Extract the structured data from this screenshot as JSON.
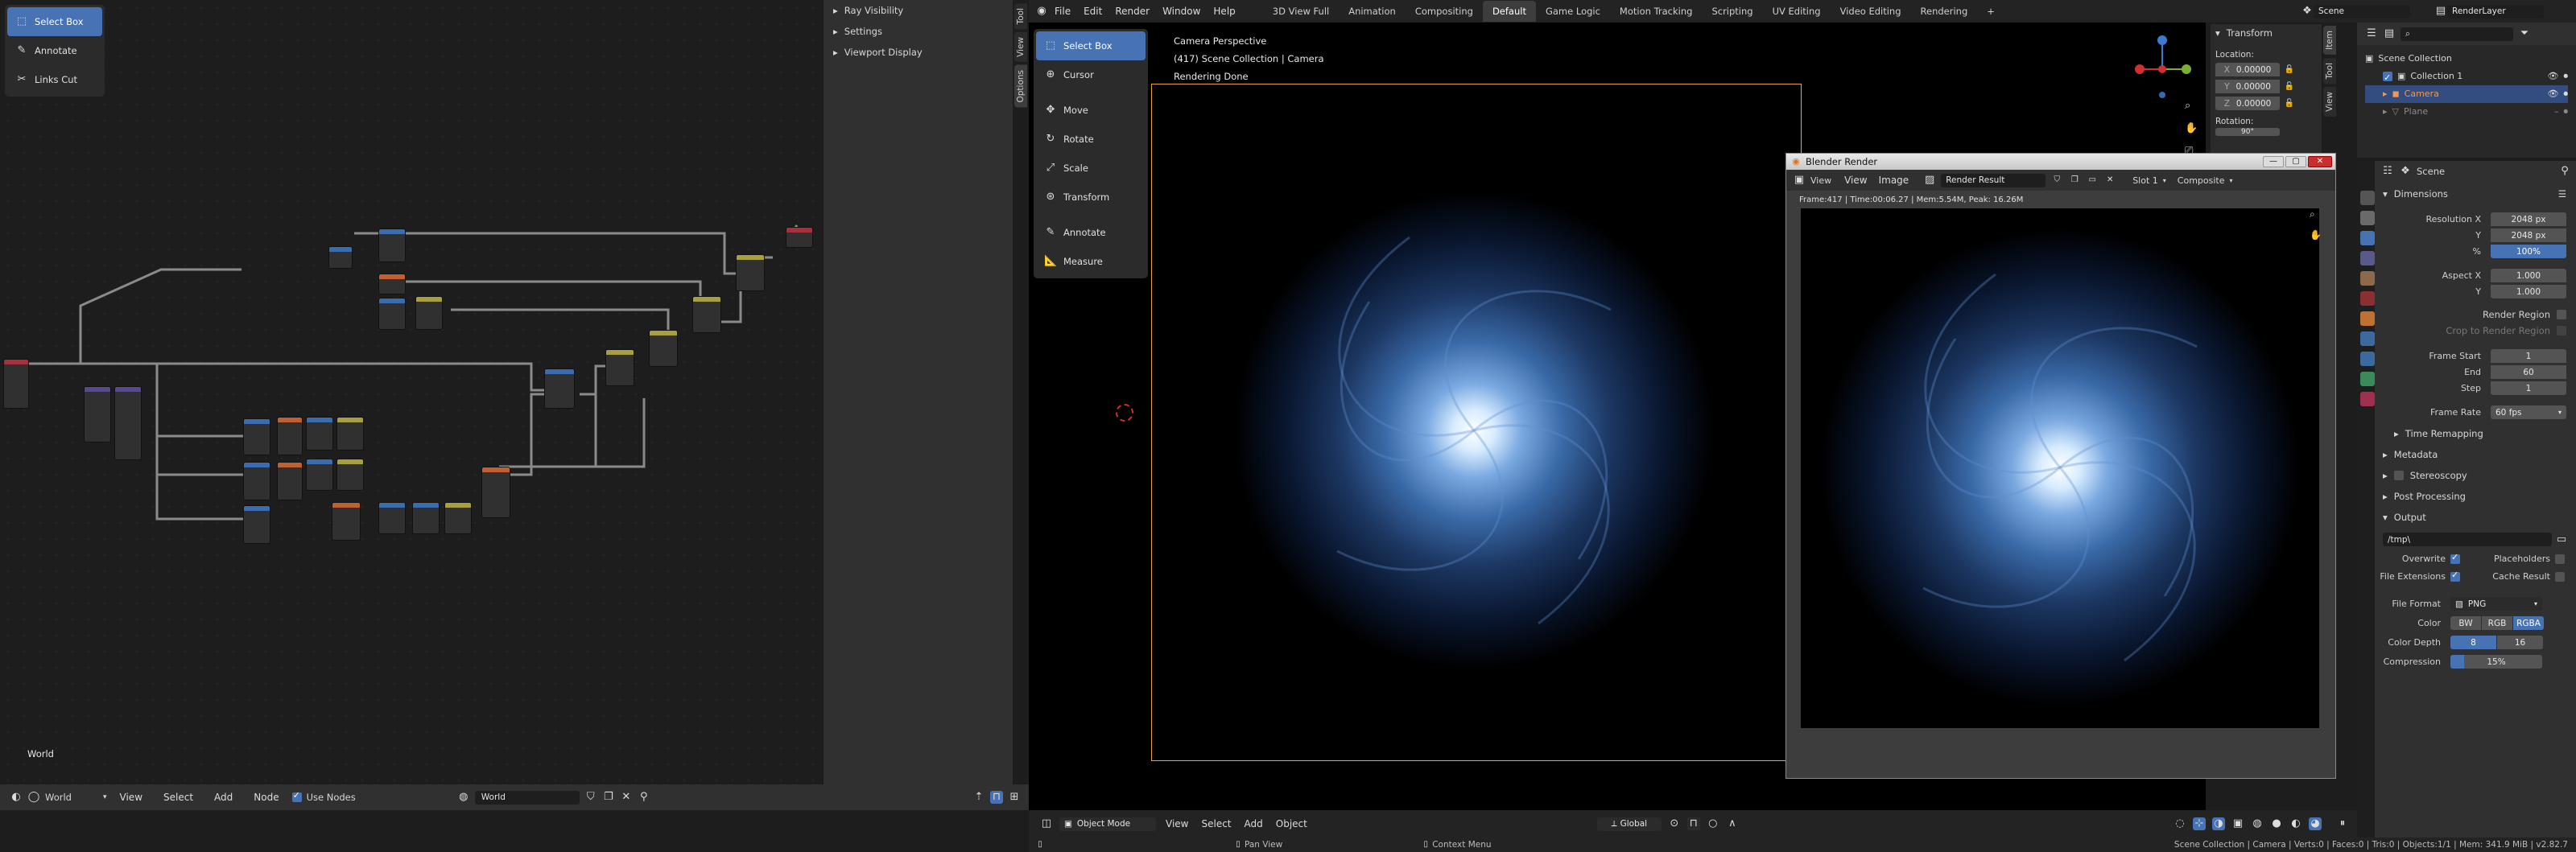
{
  "node_editor": {
    "tools": [
      {
        "label": "Select Box",
        "icon": "select-box-icon",
        "active": true
      },
      {
        "label": "Annotate",
        "icon": "annotate-icon",
        "active": false
      },
      {
        "label": "Links Cut",
        "icon": "links-cut-icon",
        "active": false
      }
    ],
    "world_label": "World",
    "header": {
      "editor_type": "World",
      "menus": [
        "View",
        "Select",
        "Add",
        "Node"
      ],
      "use_nodes_label": "Use Nodes",
      "use_nodes_checked": true,
      "datablock": "World"
    }
  },
  "world_sidebar": {
    "sections": [
      "Ray Visibility",
      "Settings",
      "Viewport Display"
    ],
    "tabs": [
      "Tool",
      "View",
      "Options"
    ]
  },
  "topbar": {
    "menus": [
      "File",
      "Edit",
      "Render",
      "Window",
      "Help"
    ],
    "workspaces": [
      "3D View Full",
      "Animation",
      "Compositing",
      "Default",
      "Game Logic",
      "Motion Tracking",
      "Scripting",
      "UV Editing",
      "Video Editing",
      "Rendering"
    ],
    "active_workspace": "Default",
    "scene": "Scene",
    "view_layer": "RenderLayer"
  },
  "viewport": {
    "tools": [
      {
        "label": "Select Box",
        "active": true
      },
      {
        "label": "Cursor",
        "active": false
      },
      {
        "label": "Move",
        "active": false
      },
      {
        "label": "Rotate",
        "active": false
      },
      {
        "label": "Scale",
        "active": false
      },
      {
        "label": "Transform",
        "active": false
      },
      {
        "label": "Annotate",
        "active": false
      },
      {
        "label": "Measure",
        "active": false
      }
    ],
    "overlay_line1": "Camera Perspective",
    "overlay_line2": "(417) Scene Collection | Camera",
    "overlay_line3": "Rendering Done",
    "transform": {
      "title": "Transform",
      "location_label": "Location:",
      "x": "0.00000",
      "y": "0.00000",
      "z": "0.00000",
      "rotation_label": "Rotation:",
      "rot_x": "90°"
    },
    "sidebar_tabs": [
      "Item",
      "Tool",
      "View"
    ],
    "header": {
      "mode": "Object Mode",
      "menus": [
        "View",
        "Select",
        "Add",
        "Object"
      ],
      "orientation": "Global"
    }
  },
  "render_window": {
    "title": "Blender Render",
    "menus": [
      "View",
      "View",
      "Image"
    ],
    "image_name": "Render Result",
    "slot": "Slot 1",
    "pass": "Composite",
    "stats": "Frame:417 | Time:00:06.27 | Mem:5.54M, Peak: 16.26M"
  },
  "outliner": {
    "root": "Scene Collection",
    "items": [
      "Collection 1",
      "Camera",
      "Plane"
    ]
  },
  "properties": {
    "scene_name": "Scene",
    "dimensions_title": "Dimensions",
    "resolution_x_label": "Resolution X",
    "resolution_x": "2048 px",
    "resolution_y_label": "Y",
    "resolution_y": "2048 px",
    "percent_label": "%",
    "percent": "100%",
    "aspect_x_label": "Aspect X",
    "aspect_x": "1.000",
    "aspect_y_label": "Y",
    "aspect_y": "1.000",
    "render_region": "Render Region",
    "crop_region": "Crop to Render Region",
    "frame_start_label": "Frame Start",
    "frame_start": "1",
    "end_label": "End",
    "end": "60",
    "step_label": "Step",
    "step": "1",
    "frame_rate_label": "Frame Rate",
    "frame_rate": "60 fps",
    "time_remapping": "Time Remapping",
    "metadata": "Metadata",
    "stereoscopy": "Stereoscopy",
    "post_processing": "Post Processing",
    "output_title": "Output",
    "output_path": "/tmp\\",
    "overwrite": "Overwrite",
    "placeholders": "Placeholders",
    "file_extensions": "File Extensions",
    "cache_result": "Cache Result",
    "file_format_label": "File Format",
    "file_format": "PNG",
    "color_label": "Color",
    "color_options": [
      "BW",
      "RGB",
      "RGBA"
    ],
    "color_depth_label": "Color Depth",
    "depth_options": [
      "8",
      "16"
    ],
    "compression_label": "Compression",
    "compression": "15%",
    "compression_value": 0.15
  },
  "statusbar": {
    "pan": "Pan View",
    "context": "Context Menu",
    "stats": "Scene Collection | Camera | Verts:0 | Faces:0 | Tris:0 | Objects:1/1 | Mem: 341.9 MiB | v2.82.7"
  },
  "colors": {
    "accent": "#4772b3",
    "camera_frame": "#e8a33a",
    "panel_bg": "#303030",
    "node_blue": "#3b6cb0",
    "node_orange": "#c06030",
    "node_red": "#a8303a",
    "node_yellow": "#a8a040"
  }
}
